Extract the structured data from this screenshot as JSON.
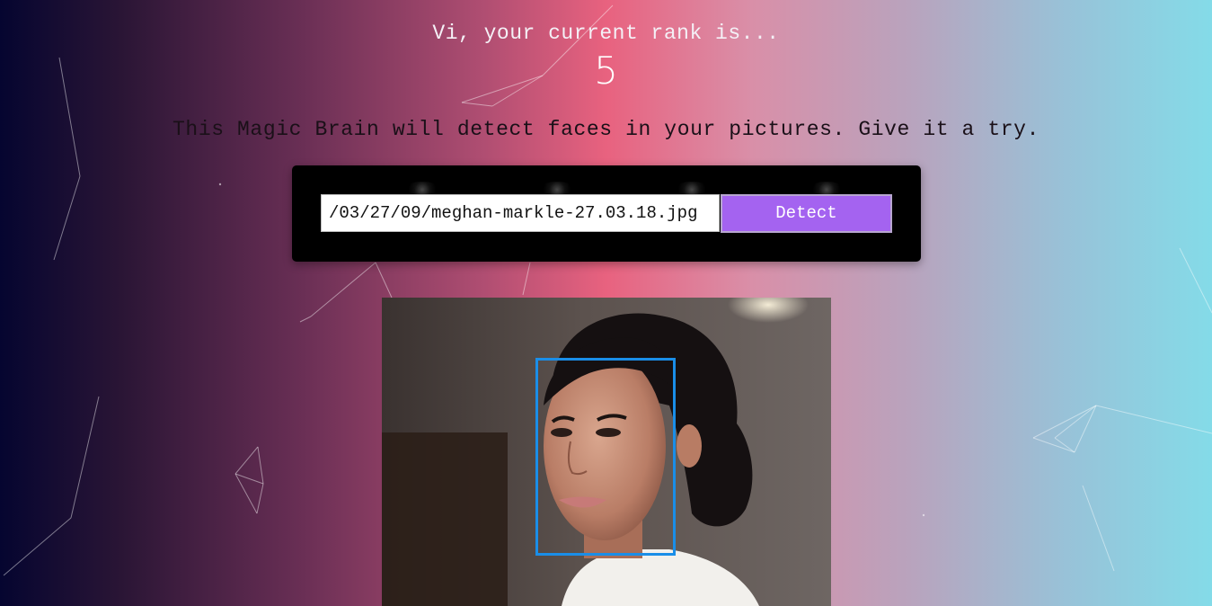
{
  "header": {
    "rank_message": "Vi, your current rank is...",
    "rank_value": "5"
  },
  "intro": {
    "tagline": "This Magic Brain will detect faces in your pictures. Give it a try."
  },
  "form": {
    "url_value": "/03/27/09/meghan-markle-27.03.18.jpg",
    "detect_label": "Detect"
  },
  "result": {
    "face_box_count": 1
  },
  "colors": {
    "detect_button": "#a463f0",
    "face_box": "#1a8ee8",
    "form_panel": "#000000"
  },
  "icons": {
    "background": "particle-network"
  }
}
